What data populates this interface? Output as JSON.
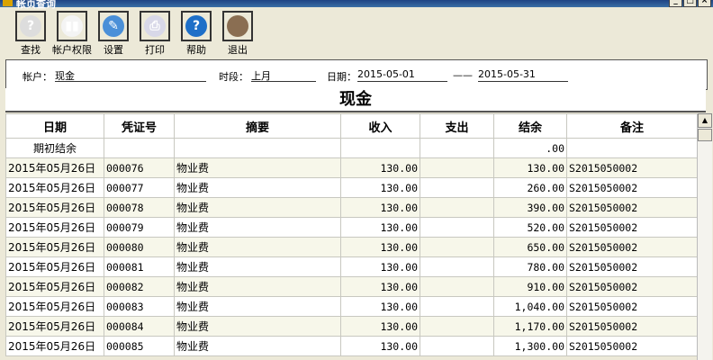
{
  "window": {
    "title": "帐页查询"
  },
  "toolbar": [
    {
      "label": "查找",
      "icon": "search-doc-icon"
    },
    {
      "label": "帐户权限",
      "icon": "permissions-icon"
    },
    {
      "label": "设置",
      "icon": "settings-icon"
    },
    {
      "label": "打印",
      "icon": "printer-icon"
    },
    {
      "label": "帮助",
      "icon": "help-icon"
    },
    {
      "label": "退出",
      "icon": "exit-icon"
    }
  ],
  "filter": {
    "account_label": "帐户：",
    "account": "现金",
    "period_label": "时段：",
    "period": "上月",
    "date_label": "日期：",
    "date_from": "2015-05-01",
    "dash": "——",
    "date_to": "2015-05-31"
  },
  "report_title": "现金",
  "columns": [
    "日期",
    "凭证号",
    "摘要",
    "收入",
    "支出",
    "结余",
    "备注"
  ],
  "rows": [
    [
      "期初结余",
      "",
      "",
      "",
      "",
      ".00",
      ""
    ],
    [
      "2015年05月26日",
      "000076",
      "物业费",
      "130.00",
      "",
      "130.00",
      "S2015050002"
    ],
    [
      "2015年05月26日",
      "000077",
      "物业费",
      "130.00",
      "",
      "260.00",
      "S2015050002"
    ],
    [
      "2015年05月26日",
      "000078",
      "物业费",
      "130.00",
      "",
      "390.00",
      "S2015050002"
    ],
    [
      "2015年05月26日",
      "000079",
      "物业费",
      "130.00",
      "",
      "520.00",
      "S2015050002"
    ],
    [
      "2015年05月26日",
      "000080",
      "物业费",
      "130.00",
      "",
      "650.00",
      "S2015050002"
    ],
    [
      "2015年05月26日",
      "000081",
      "物业费",
      "130.00",
      "",
      "780.00",
      "S2015050002"
    ],
    [
      "2015年05月26日",
      "000082",
      "物业费",
      "130.00",
      "",
      "910.00",
      "S2015050002"
    ],
    [
      "2015年05月26日",
      "000083",
      "物业费",
      "130.00",
      "",
      "1,040.00",
      "S2015050002"
    ],
    [
      "2015年05月26日",
      "000084",
      "物业费",
      "130.00",
      "",
      "1,170.00",
      "S2015050002"
    ],
    [
      "2015年05月26日",
      "000085",
      "物业费",
      "130.00",
      "",
      "1,300.00",
      "S2015050002"
    ]
  ]
}
